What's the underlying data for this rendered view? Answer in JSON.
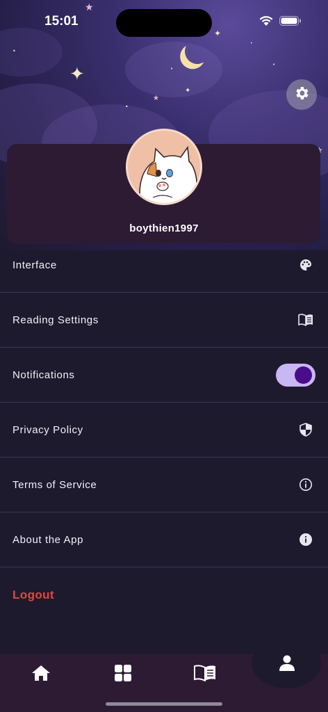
{
  "status_bar": {
    "time": "15:01"
  },
  "profile": {
    "username": "boythien1997"
  },
  "menu": {
    "items": [
      {
        "label": "Interface",
        "icon": "palette-icon"
      },
      {
        "label": "Reading Settings",
        "icon": "book-icon"
      },
      {
        "label": "Notifications",
        "control": "toggle",
        "enabled": true
      },
      {
        "label": "Privacy Policy",
        "icon": "shield-icon"
      },
      {
        "label": "Terms of Service",
        "icon": "info-outline-icon"
      },
      {
        "label": "About the App",
        "icon": "info-filled-icon"
      }
    ],
    "logout_label": "Logout"
  },
  "tab_bar": {
    "tabs": [
      {
        "icon": "home-icon"
      },
      {
        "icon": "grid-icon"
      },
      {
        "icon": "book-icon"
      },
      {
        "icon": "person-icon",
        "active": true
      }
    ]
  },
  "colors": {
    "background": "#1e1a2e",
    "card": "#2d1b34",
    "logout": "#e5483c",
    "toggle_track": "#c9b6f5",
    "toggle_knob": "#4a0d8a"
  }
}
